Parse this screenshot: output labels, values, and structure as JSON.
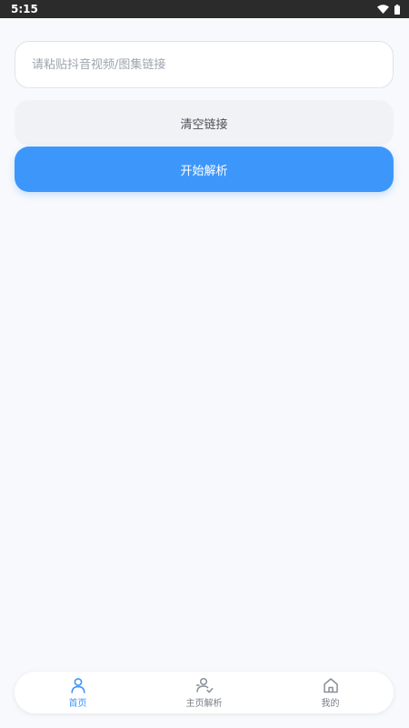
{
  "status_bar": {
    "time": "5:15",
    "icons": [
      "wifi-icon",
      "battery-icon"
    ]
  },
  "link_input": {
    "placeholder": "请粘贴抖音视频/图集链接",
    "value": ""
  },
  "buttons": {
    "clear_label": "清空链接",
    "parse_label": "开始解析"
  },
  "bottom_nav": {
    "items": [
      {
        "label": "首页",
        "icon": "person-icon",
        "active": true
      },
      {
        "label": "主页解析",
        "icon": "profile-parse-icon",
        "active": false
      },
      {
        "label": "我的",
        "icon": "home-icon",
        "active": false
      }
    ]
  },
  "colors": {
    "accent": "#3d97fb",
    "background": "#f7f9fc",
    "secondary_button": "#f1f2f5",
    "inactive_icon": "#8a8f97"
  }
}
